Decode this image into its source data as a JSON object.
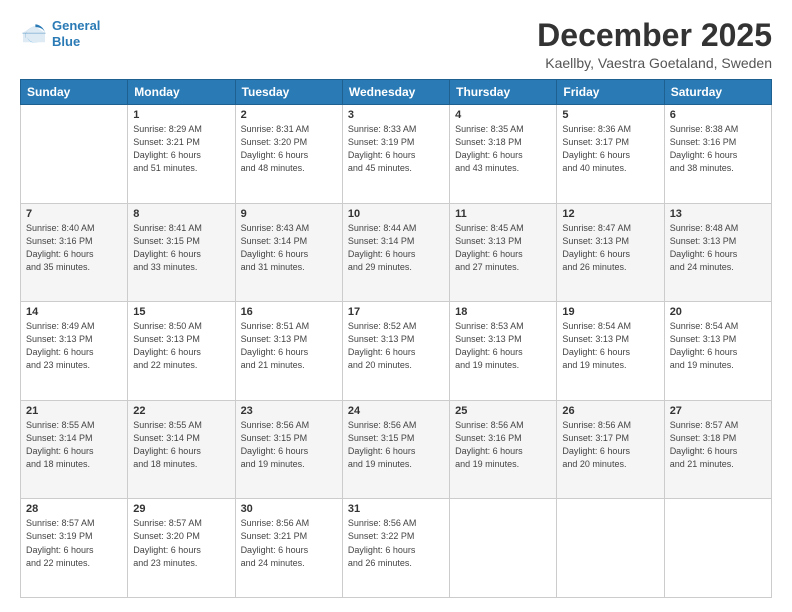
{
  "logo": {
    "line1": "General",
    "line2": "Blue"
  },
  "title": "December 2025",
  "location": "Kaellby, Vaestra Goetaland, Sweden",
  "days_header": [
    "Sunday",
    "Monday",
    "Tuesday",
    "Wednesday",
    "Thursday",
    "Friday",
    "Saturday"
  ],
  "weeks": [
    [
      {
        "day": "",
        "info": ""
      },
      {
        "day": "1",
        "info": "Sunrise: 8:29 AM\nSunset: 3:21 PM\nDaylight: 6 hours\nand 51 minutes."
      },
      {
        "day": "2",
        "info": "Sunrise: 8:31 AM\nSunset: 3:20 PM\nDaylight: 6 hours\nand 48 minutes."
      },
      {
        "day": "3",
        "info": "Sunrise: 8:33 AM\nSunset: 3:19 PM\nDaylight: 6 hours\nand 45 minutes."
      },
      {
        "day": "4",
        "info": "Sunrise: 8:35 AM\nSunset: 3:18 PM\nDaylight: 6 hours\nand 43 minutes."
      },
      {
        "day": "5",
        "info": "Sunrise: 8:36 AM\nSunset: 3:17 PM\nDaylight: 6 hours\nand 40 minutes."
      },
      {
        "day": "6",
        "info": "Sunrise: 8:38 AM\nSunset: 3:16 PM\nDaylight: 6 hours\nand 38 minutes."
      }
    ],
    [
      {
        "day": "7",
        "info": "Sunrise: 8:40 AM\nSunset: 3:16 PM\nDaylight: 6 hours\nand 35 minutes."
      },
      {
        "day": "8",
        "info": "Sunrise: 8:41 AM\nSunset: 3:15 PM\nDaylight: 6 hours\nand 33 minutes."
      },
      {
        "day": "9",
        "info": "Sunrise: 8:43 AM\nSunset: 3:14 PM\nDaylight: 6 hours\nand 31 minutes."
      },
      {
        "day": "10",
        "info": "Sunrise: 8:44 AM\nSunset: 3:14 PM\nDaylight: 6 hours\nand 29 minutes."
      },
      {
        "day": "11",
        "info": "Sunrise: 8:45 AM\nSunset: 3:13 PM\nDaylight: 6 hours\nand 27 minutes."
      },
      {
        "day": "12",
        "info": "Sunrise: 8:47 AM\nSunset: 3:13 PM\nDaylight: 6 hours\nand 26 minutes."
      },
      {
        "day": "13",
        "info": "Sunrise: 8:48 AM\nSunset: 3:13 PM\nDaylight: 6 hours\nand 24 minutes."
      }
    ],
    [
      {
        "day": "14",
        "info": "Sunrise: 8:49 AM\nSunset: 3:13 PM\nDaylight: 6 hours\nand 23 minutes."
      },
      {
        "day": "15",
        "info": "Sunrise: 8:50 AM\nSunset: 3:13 PM\nDaylight: 6 hours\nand 22 minutes."
      },
      {
        "day": "16",
        "info": "Sunrise: 8:51 AM\nSunset: 3:13 PM\nDaylight: 6 hours\nand 21 minutes."
      },
      {
        "day": "17",
        "info": "Sunrise: 8:52 AM\nSunset: 3:13 PM\nDaylight: 6 hours\nand 20 minutes."
      },
      {
        "day": "18",
        "info": "Sunrise: 8:53 AM\nSunset: 3:13 PM\nDaylight: 6 hours\nand 19 minutes."
      },
      {
        "day": "19",
        "info": "Sunrise: 8:54 AM\nSunset: 3:13 PM\nDaylight: 6 hours\nand 19 minutes."
      },
      {
        "day": "20",
        "info": "Sunrise: 8:54 AM\nSunset: 3:13 PM\nDaylight: 6 hours\nand 19 minutes."
      }
    ],
    [
      {
        "day": "21",
        "info": "Sunrise: 8:55 AM\nSunset: 3:14 PM\nDaylight: 6 hours\nand 18 minutes."
      },
      {
        "day": "22",
        "info": "Sunrise: 8:55 AM\nSunset: 3:14 PM\nDaylight: 6 hours\nand 18 minutes."
      },
      {
        "day": "23",
        "info": "Sunrise: 8:56 AM\nSunset: 3:15 PM\nDaylight: 6 hours\nand 19 minutes."
      },
      {
        "day": "24",
        "info": "Sunrise: 8:56 AM\nSunset: 3:15 PM\nDaylight: 6 hours\nand 19 minutes."
      },
      {
        "day": "25",
        "info": "Sunrise: 8:56 AM\nSunset: 3:16 PM\nDaylight: 6 hours\nand 19 minutes."
      },
      {
        "day": "26",
        "info": "Sunrise: 8:56 AM\nSunset: 3:17 PM\nDaylight: 6 hours\nand 20 minutes."
      },
      {
        "day": "27",
        "info": "Sunrise: 8:57 AM\nSunset: 3:18 PM\nDaylight: 6 hours\nand 21 minutes."
      }
    ],
    [
      {
        "day": "28",
        "info": "Sunrise: 8:57 AM\nSunset: 3:19 PM\nDaylight: 6 hours\nand 22 minutes."
      },
      {
        "day": "29",
        "info": "Sunrise: 8:57 AM\nSunset: 3:20 PM\nDaylight: 6 hours\nand 23 minutes."
      },
      {
        "day": "30",
        "info": "Sunrise: 8:56 AM\nSunset: 3:21 PM\nDaylight: 6 hours\nand 24 minutes."
      },
      {
        "day": "31",
        "info": "Sunrise: 8:56 AM\nSunset: 3:22 PM\nDaylight: 6 hours\nand 26 minutes."
      },
      {
        "day": "",
        "info": ""
      },
      {
        "day": "",
        "info": ""
      },
      {
        "day": "",
        "info": ""
      }
    ]
  ]
}
